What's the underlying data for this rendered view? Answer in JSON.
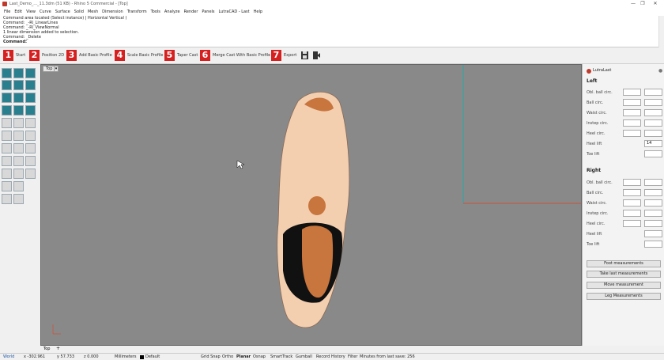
{
  "window": {
    "title": "Last_Demo_..._11.3dm (51 KB) - Rhino 5 Commercial - [Top]",
    "controls": [
      "—",
      "❐",
      "✕"
    ]
  },
  "menu": [
    "File",
    "Edit",
    "View",
    "Curve",
    "Surface",
    "Solid",
    "Mesh",
    "Dimension",
    "Transform",
    "Tools",
    "Analyze",
    "Render",
    "Panels",
    "LutraCAD - Last",
    "Help"
  ],
  "command_history": [
    "Command area located (Select instance) | Horizontal  Vertical )",
    "Command: _-Rl_LinearLines",
    "Command: _-Rl_ViewNormal",
    "1 linear dimension added to selection.",
    "Command: _Delete"
  ],
  "command_prompt": "Command:",
  "steps": [
    {
      "num": "1",
      "label": "Start"
    },
    {
      "num": "2",
      "label": "Position 2D"
    },
    {
      "num": "3",
      "label": "Add Basic Profile"
    },
    {
      "num": "4",
      "label": "Scale Basic Profile"
    },
    {
      "num": "5",
      "label": "Taper Cast"
    },
    {
      "num": "6",
      "label": "Merge Cast With Basic Profile"
    },
    {
      "num": "7",
      "label": "Export"
    }
  ],
  "viewport": {
    "tab": "Top",
    "bottom_tab": "Top"
  },
  "panel": {
    "title": "LutraLast",
    "left_title": "Left",
    "right_title": "Right",
    "left_rows": [
      {
        "label": "Obl. ball circ.",
        "a": "",
        "b": ""
      },
      {
        "label": "Ball circ.",
        "a": "",
        "b": ""
      },
      {
        "label": "Waist circ.",
        "a": "",
        "b": ""
      },
      {
        "label": "Instep circ.",
        "a": "",
        "b": ""
      },
      {
        "label": "Heel circ.",
        "a": "",
        "b": ""
      },
      {
        "label": "Heel lift",
        "a": null,
        "b": "14"
      },
      {
        "label": "Toe lift",
        "a": null,
        "b": ""
      }
    ],
    "right_rows": [
      {
        "label": "Obl. ball circ.",
        "a": "",
        "b": ""
      },
      {
        "label": "Ball circ.",
        "a": "",
        "b": ""
      },
      {
        "label": "Waist circ.",
        "a": "",
        "b": ""
      },
      {
        "label": "Instep circ.",
        "a": "",
        "b": ""
      },
      {
        "label": "Heel circ.",
        "a": "",
        "b": ""
      },
      {
        "label": "Heel lift",
        "a": null,
        "b": ""
      },
      {
        "label": "Toe lift",
        "a": null,
        "b": ""
      }
    ],
    "buttons": [
      "Foot measurements",
      "Take last measurements",
      "Move measurement",
      "Leg Measurements"
    ]
  },
  "status": {
    "cplane": "World",
    "x": "x -302.961",
    "y": "y 57.733",
    "z": "z 0.000",
    "units": "Millimeters",
    "layer": "Default",
    "toggles": [
      "Grid Snap",
      "Ortho",
      "Planar",
      "Osnap",
      "SmartTrack",
      "Gumball",
      "Record History",
      "Filter"
    ],
    "save_info": "Minutes from last save: 256"
  },
  "colors": {
    "viewport_bg": "#898989",
    "step_red": "#d62020",
    "skin": "#f3cfb0",
    "spot": "#c8753e"
  }
}
